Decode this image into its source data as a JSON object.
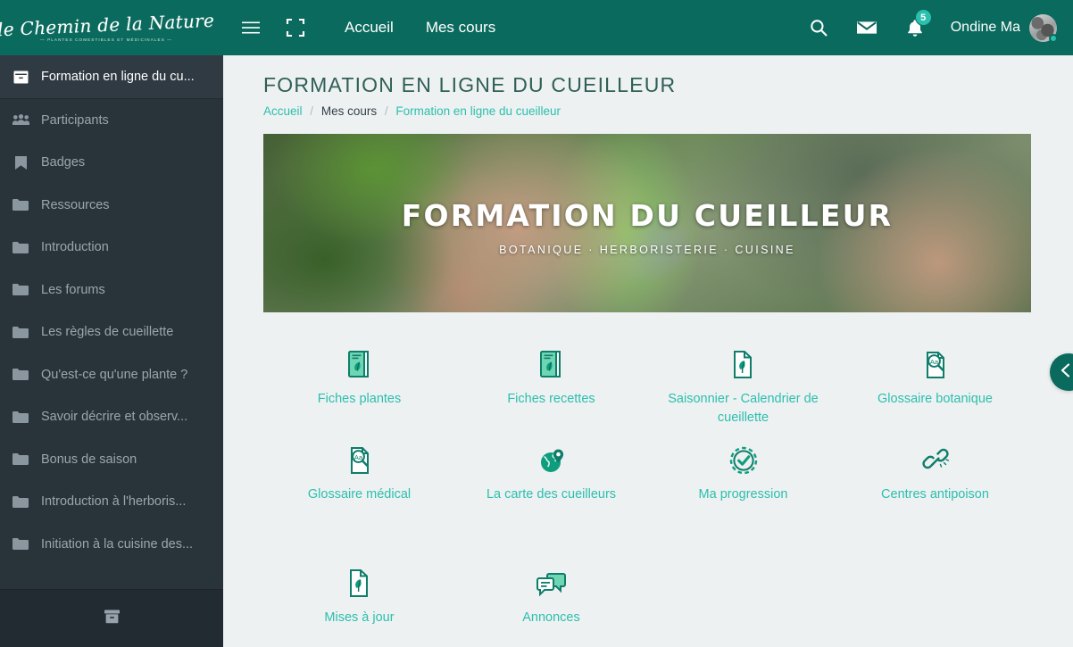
{
  "header": {
    "logo_script": "le Chemin de la Nature",
    "logo_sub": "— PLANTES COMESTIBLES ET MÉDICINALES —",
    "burger_icon": "hamburger-menu-icon",
    "fullscreen_icon": "fullscreen-icon",
    "nav": [
      {
        "label": "Accueil"
      },
      {
        "label": "Mes cours"
      }
    ],
    "search_icon": "search-icon",
    "mail_icon": "envelope-icon",
    "bell_icon": "bell-icon",
    "bell_badge": "5",
    "user_name": "Ondine Ma",
    "avatar_icon": "avatar",
    "colors": {
      "header_green": "#0a6a5d",
      "accent_teal": "#2bbfad",
      "sidebar_dark": "#29333a"
    }
  },
  "sidebar": {
    "items": [
      {
        "label": "Formation en ligne du cu...",
        "icon": "course-box-icon",
        "active": true
      },
      {
        "label": "Participants",
        "icon": "users-icon",
        "active": false
      },
      {
        "label": "Badges",
        "icon": "badge-bookmark-icon",
        "active": false
      },
      {
        "label": "Ressources",
        "icon": "folder-icon",
        "active": false
      },
      {
        "label": "Introduction",
        "icon": "folder-icon",
        "active": false
      },
      {
        "label": "Les forums",
        "icon": "folder-icon",
        "active": false
      },
      {
        "label": "Les règles de cueillette",
        "icon": "folder-icon",
        "active": false
      },
      {
        "label": "Qu'est-ce qu'une plante ?",
        "icon": "folder-icon",
        "active": false
      },
      {
        "label": "Savoir décrire et observ...",
        "icon": "folder-icon",
        "active": false
      },
      {
        "label": "Bonus de saison",
        "icon": "folder-icon",
        "active": false
      },
      {
        "label": "Introduction à l'herboris...",
        "icon": "folder-icon",
        "active": false
      },
      {
        "label": "Initiation à la cuisine des...",
        "icon": "folder-icon",
        "active": false
      }
    ],
    "footer_icon": "archive-box-icon"
  },
  "main": {
    "page_title": "FORMATION EN LIGNE DU CUEILLEUR",
    "breadcrumb": {
      "home": "Accueil",
      "courses": "Mes cours",
      "current": "Formation en ligne du cueilleur",
      "separator": "/"
    },
    "banner": {
      "title": "FORMATION DU CUEILLEUR",
      "subtitle": "BOTANIQUE · HERBORISTERIE · CUISINE",
      "alt": "hand holding a plant with purple flowers"
    },
    "activities": [
      {
        "label": "Fiches plantes",
        "icon": "book-leaf-icon"
      },
      {
        "label": "Fiches recettes",
        "icon": "book-leaf-icon"
      },
      {
        "label": "Saisonnier - Calendrier de cueillette",
        "icon": "page-leaf-icon"
      },
      {
        "label": "Glossaire botanique",
        "icon": "glossary-aa-icon"
      },
      {
        "label": "Glossaire médical",
        "icon": "glossary-aa-icon"
      },
      {
        "label": "La carte des cueilleurs",
        "icon": "globe-pin-icon"
      },
      {
        "label": "Ma progression",
        "icon": "progress-check-icon"
      },
      {
        "label": "Centres antipoison",
        "icon": "link-chain-icon"
      },
      {
        "label": "Mises à jour",
        "icon": "page-leaf-icon"
      },
      {
        "label": "Annonces",
        "icon": "chat-bubbles-icon"
      }
    ],
    "drawer_handle_icon": "chevron-left-icon"
  }
}
